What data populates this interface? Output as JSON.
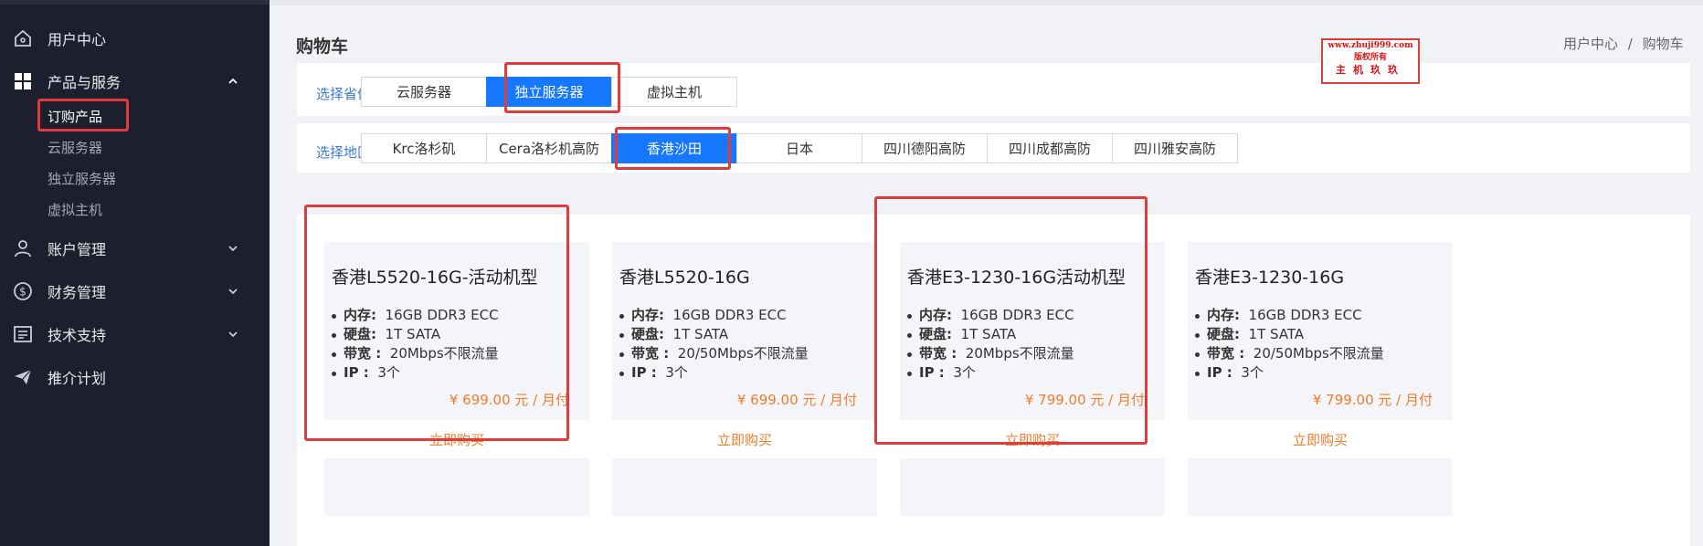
{
  "sidebar": {
    "items": [
      {
        "label": "用户中心",
        "icon": "home-icon"
      },
      {
        "label": "产品与服务",
        "icon": "grid-icon"
      },
      {
        "label": "账户管理",
        "icon": "user-icon"
      },
      {
        "label": "财务管理",
        "icon": "dollar-icon"
      },
      {
        "label": "技术支持",
        "icon": "document-icon"
      },
      {
        "label": "推介计划",
        "icon": "send-icon"
      }
    ],
    "sub_items": [
      "订购产品",
      "云服务器",
      "独立服务器",
      "虚拟主机"
    ]
  },
  "header": {
    "title": "购物车",
    "breadcrumb": [
      "用户中心",
      "购物车"
    ],
    "breadcrumb_sep": "/"
  },
  "watermark": {
    "url": "www.zhuji999.com",
    "line2": "版权所有",
    "line3": "主机玖玖"
  },
  "filters": {
    "province": {
      "label": "选择省份",
      "options": [
        "云服务器",
        "独立服务器",
        "虚拟主机"
      ],
      "selected": "独立服务器"
    },
    "region": {
      "label": "选择地区",
      "options": [
        "Krc洛杉矶",
        "Cera洛杉机高防",
        "香港沙田",
        "日本",
        "四川德阳高防",
        "四川成都高防",
        "四川雅安高防"
      ],
      "selected": "香港沙田"
    }
  },
  "products": [
    {
      "name": "香港L5520-16G-活动机型",
      "specs": [
        {
          "key": "内存:",
          "value": "16GB DDR3 ECC"
        },
        {
          "key": "硬盘:",
          "value": "1T SATA"
        },
        {
          "key": "带宽 :",
          "value": "20Mbps不限流量"
        },
        {
          "key": "IP :",
          "value": "3个"
        }
      ],
      "price": "¥ 699.00 元 / 月付",
      "buy_label": "立即购买"
    },
    {
      "name": "香港L5520-16G",
      "specs": [
        {
          "key": "内存:",
          "value": "16GB DDR3 ECC"
        },
        {
          "key": "硬盘:",
          "value": "1T SATA"
        },
        {
          "key": "带宽 :",
          "value": "20/50Mbps不限流量"
        },
        {
          "key": "IP :",
          "value": "3个"
        }
      ],
      "price": "¥ 699.00 元 / 月付",
      "buy_label": "立即购买"
    },
    {
      "name": "香港E3-1230-16G活动机型",
      "specs": [
        {
          "key": "内存:",
          "value": "16GB DDR3 ECC"
        },
        {
          "key": "硬盘:",
          "value": "1T SATA"
        },
        {
          "key": "带宽 :",
          "value": "20Mbps不限流量"
        },
        {
          "key": "IP :",
          "value": "3个"
        }
      ],
      "price": "¥ 799.00 元 / 月付",
      "buy_label": "立即购买"
    },
    {
      "name": "香港E3-1230-16G",
      "specs": [
        {
          "key": "内存:",
          "value": "16GB DDR3 ECC"
        },
        {
          "key": "硬盘:",
          "value": "1T SATA"
        },
        {
          "key": "带宽 :",
          "value": "20/50Mbps不限流量"
        },
        {
          "key": "IP :",
          "value": "3个"
        }
      ],
      "price": "¥ 799.00 元 / 月付",
      "buy_label": "立即购买"
    }
  ],
  "colors": {
    "sidebar_bg": "#1d1f2e",
    "accent": "#1677ff",
    "price": "#f07c2c",
    "highlight_box": "#e23b3b"
  }
}
